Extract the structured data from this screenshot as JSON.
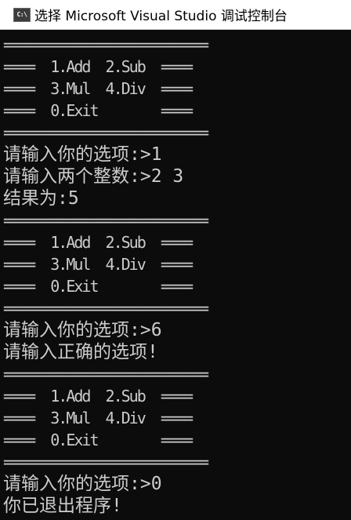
{
  "window": {
    "icon_text": "C:\\",
    "title": "选择 Microsoft Visual Studio 调试控制台"
  },
  "console": {
    "lines": [
      "==========================",
      "====  1.Add  2.Sub  ====",
      "====  3.Mul  4.Div  ====",
      "====  0.Exit        ====",
      "==========================",
      "请输入你的选项:>1",
      "请输入两个整数:>2 3",
      "结果为:5",
      "==========================",
      "====  1.Add  2.Sub  ====",
      "====  3.Mul  4.Div  ====",
      "====  0.Exit        ====",
      "==========================",
      "请输入你的选项:>6",
      "请输入正确的选项!",
      "==========================",
      "====  1.Add  2.Sub  ====",
      "====  3.Mul  4.Div  ====",
      "====  0.Exit        ====",
      "==========================",
      "请输入你的选项:>0",
      "你已退出程序!"
    ]
  }
}
